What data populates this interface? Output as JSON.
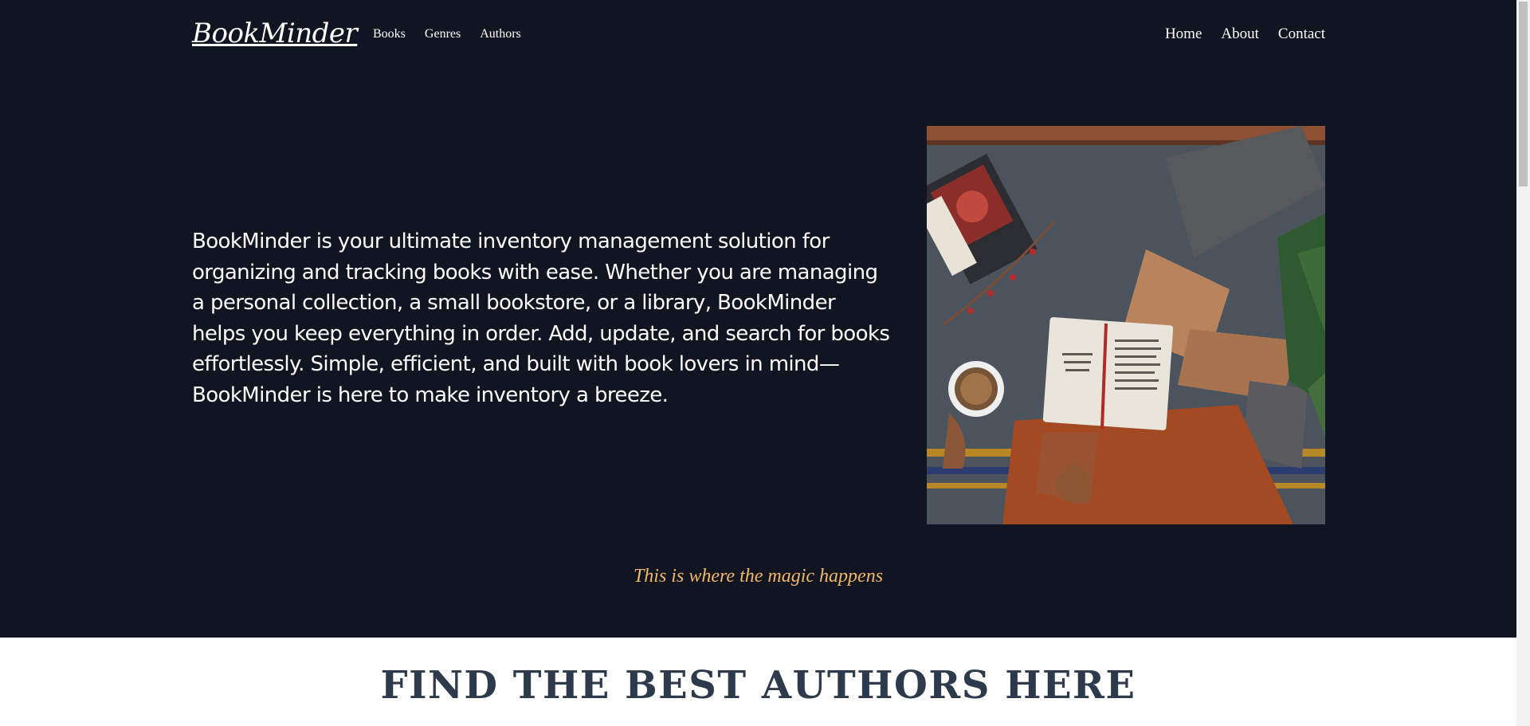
{
  "nav": {
    "brand": "BookMinder",
    "left_links": [
      "Books",
      "Genres",
      "Authors"
    ],
    "right_links": [
      "Home",
      "About",
      "Contact"
    ]
  },
  "hero": {
    "intro": "BookMinder is your ultimate inventory management solution for organizing and tracking books with ease. Whether you are managing a personal collection, a small bookstore, or a library, BookMinder helps you keep everything in order. Add, update, and search for books effortlessly. Simple, efficient, and built with book lovers in mind—BookMinder is here to make inventory a breeze.",
    "tagline": "This is where the magic happens",
    "image_icon": "reading-photo-icon"
  },
  "authors": {
    "heading": "FIND THE BEST AUTHORS HERE"
  },
  "colors": {
    "hero_bg": "#111421",
    "tagline": "#f2b866",
    "heading": "#2d3a4b"
  }
}
